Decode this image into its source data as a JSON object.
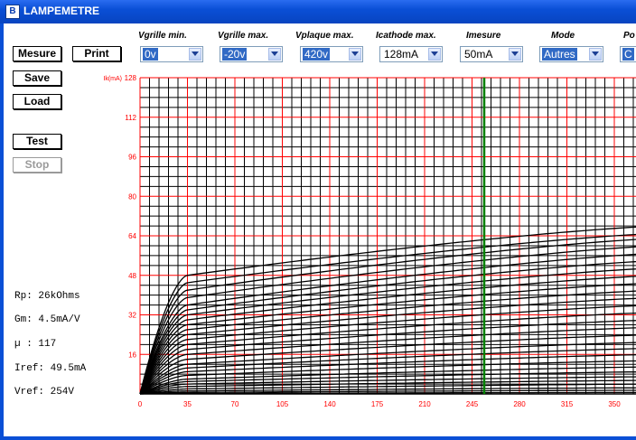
{
  "window": {
    "title": "LAMPEMETRE",
    "icon_letter": "B"
  },
  "buttons": {
    "mesure": "Mesure",
    "print": "Print",
    "save": "Save",
    "load": "Load",
    "test": "Test",
    "stop": "Stop"
  },
  "controls": [
    {
      "label": "Vgrille min.",
      "value": "0v",
      "selected": true
    },
    {
      "label": "Vgrille max.",
      "value": "-20v",
      "selected": true
    },
    {
      "label": "Vplaque max.",
      "value": "420v",
      "selected": true
    },
    {
      "label": "Icathode max.",
      "value": "128mA",
      "selected": false
    },
    {
      "label": "Imesure",
      "value": "50mA",
      "selected": false
    },
    {
      "label": "Mode",
      "value": "Autres",
      "selected": true
    },
    {
      "label": "Po",
      "value": "C",
      "selected": true
    }
  ],
  "stats": {
    "rp": "Rp: 26kOhms",
    "gm": "Gm: 4.5mA/V",
    "mu": "µ : 117",
    "iref": "Iref: 49.5mA",
    "vref": "Vref: 254V"
  },
  "colors": {
    "grid_major": "#ff0000",
    "grid_minor": "#000000",
    "curve": "#000000",
    "cursor": "#008000",
    "axis_text": "#ff0000"
  },
  "chart_data": {
    "type": "line",
    "ylabel": "Ik(mA)",
    "x_ticks": [
      0,
      35,
      70,
      105,
      140,
      175,
      210,
      245,
      280,
      315,
      350
    ],
    "y_ticks": [
      16,
      32,
      48,
      64,
      80,
      96,
      112,
      128
    ],
    "x_range": [
      0,
      385
    ],
    "ylim": [
      0,
      128
    ],
    "grid": true,
    "cursor_x": 254,
    "knee_v": 35,
    "series": [
      {
        "values_at_knee_and_end": [
          48,
          68
        ]
      },
      {
        "values_at_knee_and_end": [
          45,
          65
        ]
      },
      {
        "values_at_knee_and_end": [
          42,
          63
        ]
      },
      {
        "values_at_knee_and_end": [
          39,
          60
        ]
      },
      {
        "values_at_knee_and_end": [
          36,
          57
        ]
      },
      {
        "values_at_knee_and_end": [
          34,
          54
        ]
      },
      {
        "values_at_knee_and_end": [
          32,
          51
        ]
      },
      {
        "values_at_knee_and_end": [
          30,
          48
        ]
      },
      {
        "values_at_knee_and_end": [
          28,
          45
        ]
      },
      {
        "values_at_knee_and_end": [
          26,
          42
        ]
      },
      {
        "values_at_knee_and_end": [
          24,
          39
        ]
      },
      {
        "values_at_knee_and_end": [
          22,
          36
        ]
      },
      {
        "values_at_knee_and_end": [
          20,
          33
        ]
      },
      {
        "values_at_knee_and_end": [
          18,
          30
        ]
      },
      {
        "values_at_knee_and_end": [
          16,
          27
        ]
      },
      {
        "values_at_knee_and_end": [
          14,
          24
        ]
      },
      {
        "values_at_knee_and_end": [
          12,
          21
        ]
      },
      {
        "values_at_knee_and_end": [
          10.5,
          18.5
        ]
      },
      {
        "values_at_knee_and_end": [
          9,
          16
        ]
      },
      {
        "values_at_knee_and_end": [
          7.5,
          13.5
        ]
      },
      {
        "values_at_knee_and_end": [
          6,
          11
        ]
      },
      {
        "values_at_knee_and_end": [
          5,
          9
        ]
      },
      {
        "values_at_knee_and_end": [
          4,
          7
        ]
      },
      {
        "values_at_knee_and_end": [
          3,
          5.5
        ]
      },
      {
        "values_at_knee_and_end": [
          2,
          4
        ]
      },
      {
        "values_at_knee_and_end": [
          1.2,
          2.5
        ]
      },
      {
        "values_at_knee_and_end": [
          0.6,
          1.5
        ]
      },
      {
        "values_at_knee_and_end": [
          0.2,
          0.6
        ]
      }
    ]
  }
}
